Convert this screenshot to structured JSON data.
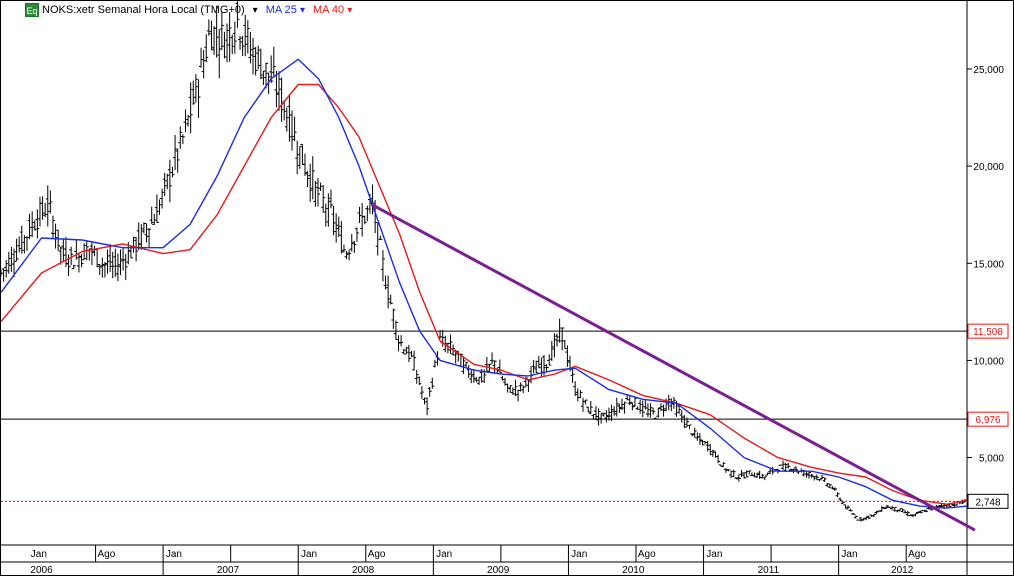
{
  "header": {
    "badge": "Eq",
    "symbol": "NOKS:xetr Semanal Hora Local (TMG+0)",
    "dropdown": "▾",
    "ma_fast": "MA 25",
    "ma_slow": "MA 40"
  },
  "colors": {
    "price": "#000000",
    "ma_fast": "#1a2ee6",
    "ma_slow": "#e61a1a",
    "trendline": "#7a1f8f",
    "hline": "#000000",
    "current": "#e61a1a",
    "badge": "#2e8b3a"
  },
  "chart_data": {
    "type": "candlestick",
    "x_axis": {
      "year_labels": [
        "2006",
        "2007",
        "2008",
        "2009",
        "2010",
        "2011",
        "2012"
      ],
      "month_labels": [
        "Jan",
        "Ago",
        "Jan",
        "Jan",
        "Ago",
        "Jan",
        "Jan",
        "Ago",
        "Jan",
        "Jan",
        "Ago"
      ],
      "range": [
        "2005-10",
        "2012-12"
      ]
    },
    "y_axis": {
      "ticks": [
        "25,000",
        "20,000",
        "15,000",
        "10,000",
        "5,000"
      ],
      "range": [
        0.5,
        28.5
      ]
    },
    "price_markers": [
      {
        "label": "11,508",
        "value": 11.508,
        "color": "#e61a1a"
      },
      {
        "label": "6,976",
        "value": 6.976,
        "color": "#e61a1a"
      },
      {
        "label": "2,748",
        "value": 2.748,
        "color": "#000000"
      }
    ],
    "horizontal_lines": [
      11.508,
      6.976
    ],
    "current_price": 2.748,
    "trendline": {
      "from": {
        "x": 2008.55,
        "y": 18.0
      },
      "to": {
        "x": 2013.0,
        "y": 1.3
      }
    },
    "series": [
      {
        "name": "NOKS:xetr",
        "kind": "close",
        "x": [
          2005.8,
          2005.95,
          2006.05,
          2006.15,
          2006.25,
          2006.35,
          2006.45,
          2006.55,
          2006.65,
          2006.75,
          2006.85,
          2006.95,
          2007.05,
          2007.15,
          2007.25,
          2007.35,
          2007.45,
          2007.55,
          2007.65,
          2007.75,
          2007.85,
          2007.95,
          2008.05,
          2008.15,
          2008.25,
          2008.35,
          2008.45,
          2008.55,
          2008.65,
          2008.75,
          2008.85,
          2008.95,
          2009.05,
          2009.15,
          2009.25,
          2009.35,
          2009.45,
          2009.55,
          2009.65,
          2009.75,
          2009.85,
          2009.95,
          2010.05,
          2010.15,
          2010.25,
          2010.35,
          2010.45,
          2010.55,
          2010.65,
          2010.75,
          2010.85,
          2010.95,
          2011.05,
          2011.15,
          2011.25,
          2011.35,
          2011.45,
          2011.55,
          2011.65,
          2011.75,
          2011.85,
          2011.95,
          2012.05,
          2012.15,
          2012.25,
          2012.35,
          2012.45,
          2012.55,
          2012.65,
          2012.75,
          2012.85,
          2012.95
        ],
        "y": [
          14.5,
          16.0,
          17.2,
          18.0,
          15.5,
          15.2,
          15.8,
          15.0,
          14.8,
          15.5,
          16.5,
          17.5,
          19.5,
          21.5,
          24.0,
          27.0,
          26.5,
          27.5,
          26.0,
          25.0,
          24.0,
          22.0,
          20.0,
          18.5,
          17.5,
          15.5,
          17.0,
          18.0,
          14.0,
          11.0,
          10.0,
          7.5,
          11.0,
          10.5,
          9.5,
          9.0,
          10.0,
          8.5,
          8.5,
          9.5,
          10.0,
          11.5,
          8.5,
          7.5,
          7.0,
          7.5,
          8.0,
          7.5,
          7.2,
          8.0,
          7.0,
          6.0,
          5.5,
          4.5,
          4.0,
          4.2,
          4.0,
          4.5,
          4.5,
          4.2,
          4.0,
          3.5,
          2.5,
          1.8,
          2.0,
          2.5,
          2.3,
          2.0,
          2.3,
          2.5,
          2.6,
          2.748
        ]
      },
      {
        "name": "MA 25",
        "kind": "moving_average",
        "x": [
          2005.8,
          2006.1,
          2006.4,
          2006.7,
          2007.0,
          2007.2,
          2007.4,
          2007.6,
          2007.8,
          2008.0,
          2008.15,
          2008.3,
          2008.45,
          2008.6,
          2008.75,
          2008.9,
          2009.05,
          2009.3,
          2009.5,
          2009.7,
          2009.9,
          2010.05,
          2010.3,
          2010.55,
          2010.8,
          2011.05,
          2011.3,
          2011.55,
          2011.8,
          2012.0,
          2012.2,
          2012.4,
          2012.6,
          2012.8,
          2012.95
        ],
        "y": [
          13.5,
          16.3,
          16.2,
          15.8,
          15.8,
          17.0,
          19.5,
          22.5,
          24.5,
          25.5,
          24.5,
          22.5,
          20.0,
          17.0,
          14.0,
          11.5,
          10.0,
          9.5,
          9.3,
          9.2,
          9.5,
          9.6,
          8.5,
          8.0,
          7.8,
          6.5,
          5.0,
          4.3,
          4.3,
          4.0,
          3.5,
          2.8,
          2.5,
          2.4,
          2.5
        ]
      },
      {
        "name": "MA 40",
        "kind": "moving_average",
        "x": [
          2005.8,
          2006.1,
          2006.4,
          2006.7,
          2007.0,
          2007.2,
          2007.4,
          2007.6,
          2007.8,
          2008.0,
          2008.15,
          2008.3,
          2008.45,
          2008.6,
          2008.75,
          2008.9,
          2009.05,
          2009.3,
          2009.5,
          2009.7,
          2009.9,
          2010.05,
          2010.3,
          2010.55,
          2010.8,
          2011.05,
          2011.3,
          2011.55,
          2011.8,
          2012.0,
          2012.2,
          2012.4,
          2012.6,
          2012.8,
          2012.95
        ],
        "y": [
          12.0,
          14.5,
          15.6,
          16.0,
          15.5,
          15.7,
          17.5,
          20.0,
          22.5,
          24.2,
          24.2,
          23.0,
          21.5,
          19.0,
          16.5,
          13.5,
          11.0,
          9.8,
          9.5,
          9.0,
          9.3,
          9.7,
          9.0,
          8.2,
          7.8,
          7.2,
          6.0,
          5.0,
          4.5,
          4.2,
          4.0,
          3.3,
          2.8,
          2.6,
          2.8
        ]
      }
    ]
  }
}
